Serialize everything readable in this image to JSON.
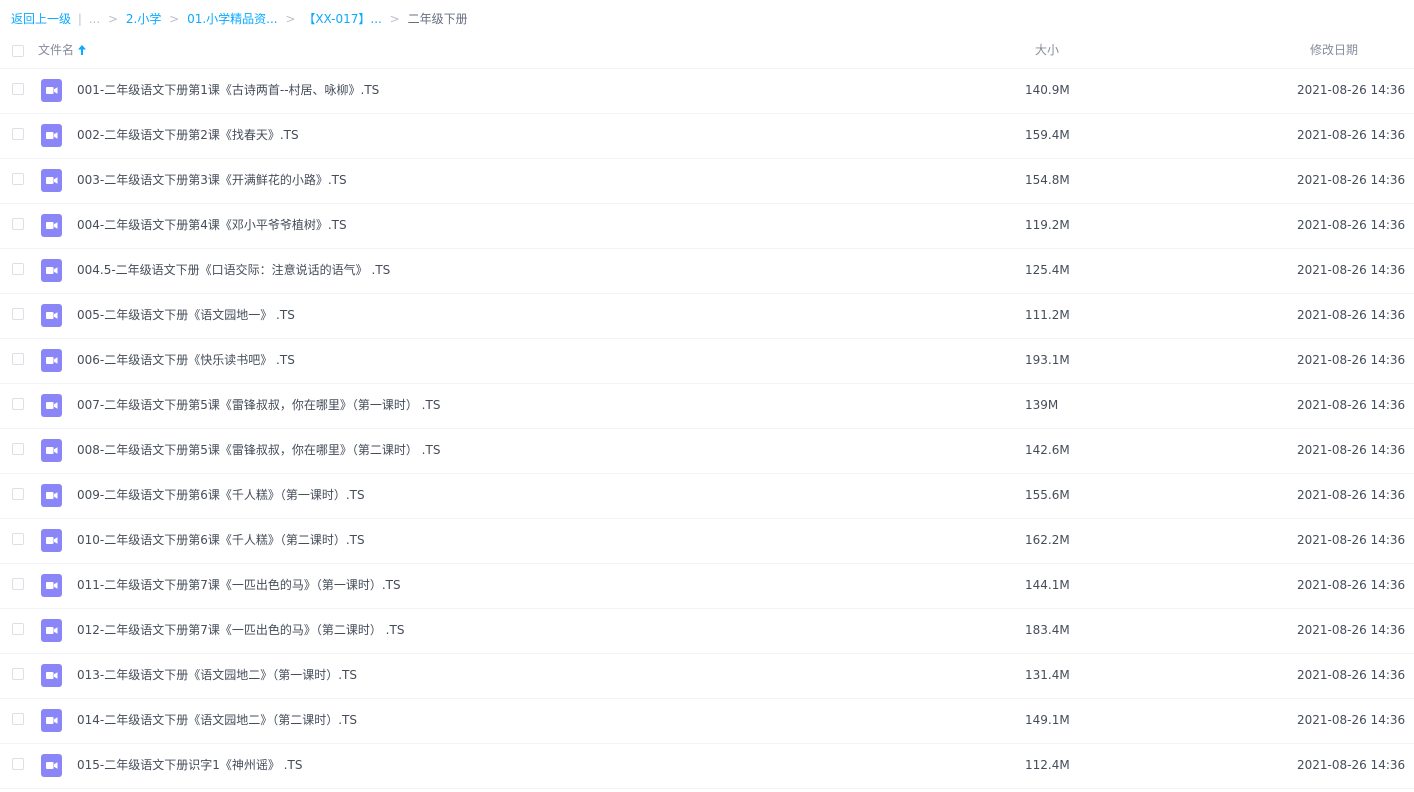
{
  "breadcrumb": {
    "back": "返回上一级",
    "pipe": "|",
    "ellipsis": "...",
    "sep": ">",
    "items": [
      "2.小学",
      "01.小学精品资...",
      "【XX-017】..."
    ],
    "current": "二年级下册"
  },
  "header": {
    "name": "文件名",
    "size": "大小",
    "date": "修改日期"
  },
  "icons": {
    "file_icon": "video-file-icon",
    "sort_icon": "arrow-up-icon"
  },
  "colors": {
    "accent": "#09aaff",
    "video_icon": "#8b86f8"
  },
  "files": [
    {
      "name": "001-二年级语文下册第1课《古诗两首--村居、咏柳》.TS",
      "size": "140.9M",
      "date": "2021-08-26 14:36"
    },
    {
      "name": "002-二年级语文下册第2课《找春天》.TS",
      "size": "159.4M",
      "date": "2021-08-26 14:36"
    },
    {
      "name": "003-二年级语文下册第3课《开满鲜花的小路》.TS",
      "size": "154.8M",
      "date": "2021-08-26 14:36"
    },
    {
      "name": "004-二年级语文下册第4课《邓小平爷爷植树》.TS",
      "size": "119.2M",
      "date": "2021-08-26 14:36"
    },
    {
      "name": "004.5-二年级语文下册《口语交际：注意说话的语气》 .TS",
      "size": "125.4M",
      "date": "2021-08-26 14:36"
    },
    {
      "name": "005-二年级语文下册《语文园地一》 .TS",
      "size": "111.2M",
      "date": "2021-08-26 14:36"
    },
    {
      "name": "006-二年级语文下册《快乐读书吧》 .TS",
      "size": "193.1M",
      "date": "2021-08-26 14:36"
    },
    {
      "name": "007-二年级语文下册第5课《雷锋叔叔，你在哪里》（第一课时） .TS",
      "size": "139M",
      "date": "2021-08-26 14:36"
    },
    {
      "name": "008-二年级语文下册第5课《雷锋叔叔，你在哪里》（第二课时） .TS",
      "size": "142.6M",
      "date": "2021-08-26 14:36"
    },
    {
      "name": "009-二年级语文下册第6课《千人糕》（第一课时）.TS",
      "size": "155.6M",
      "date": "2021-08-26 14:36"
    },
    {
      "name": "010-二年级语文下册第6课《千人糕》（第二课时）.TS",
      "size": "162.2M",
      "date": "2021-08-26 14:36"
    },
    {
      "name": "011-二年级语文下册第7课《一匹出色的马》（第一课时）.TS",
      "size": "144.1M",
      "date": "2021-08-26 14:36"
    },
    {
      "name": "012-二年级语文下册第7课《一匹出色的马》（第二课时） .TS",
      "size": "183.4M",
      "date": "2021-08-26 14:36"
    },
    {
      "name": "013-二年级语文下册《语文园地二》（第一课时）.TS",
      "size": "131.4M",
      "date": "2021-08-26 14:36"
    },
    {
      "name": "014-二年级语文下册《语文园地二》（第二课时）.TS",
      "size": "149.1M",
      "date": "2021-08-26 14:36"
    },
    {
      "name": "015-二年级语文下册识字1《神州谣》 .TS",
      "size": "112.4M",
      "date": "2021-08-26 14:36"
    }
  ]
}
